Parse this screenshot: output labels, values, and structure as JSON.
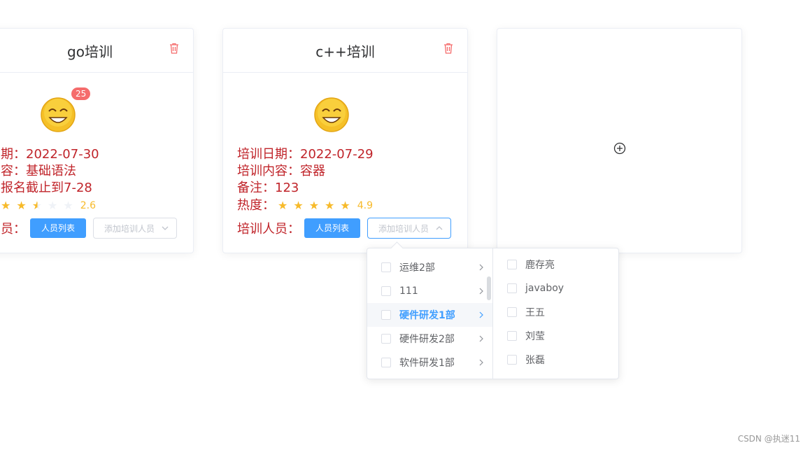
{
  "cards": [
    {
      "title": "go培训",
      "badge": "25",
      "date_line": "期：2022-07-30",
      "content_line": "容：基础语法",
      "note_line": "报名截止到7-28",
      "rating": 2.6,
      "rating_text": "2.6",
      "trainee_label": "员：",
      "list_button": "人员列表",
      "add_placeholder": "添加培训人员"
    },
    {
      "title": "c++培训",
      "date_line": "培训日期：2022-07-29",
      "content_line": "培训内容：容器",
      "note_line": "备注：123",
      "heat_label": "热度：",
      "rating": 4.9,
      "rating_text": "4.9",
      "trainee_label": "培训人员：",
      "list_button": "人员列表",
      "add_placeholder": "添加培训人员"
    }
  ],
  "cascader": {
    "departments": [
      {
        "label": "运维2部"
      },
      {
        "label": "111"
      },
      {
        "label": "硬件研发1部",
        "active": true
      },
      {
        "label": "硬件研发2部"
      },
      {
        "label": "软件研发1部"
      }
    ],
    "members": [
      "鹿存亮",
      "javaboy",
      "王五",
      "刘莹",
      "张磊"
    ]
  },
  "colors": {
    "primary": "#409eff",
    "danger_text": "#c0242a",
    "star": "#f7ba2a",
    "badge": "#f56c6c"
  },
  "icons": {
    "delete": "trash-icon",
    "add": "plus-circle-icon",
    "avatar": "smiley-face-icon"
  },
  "watermark": "CSDN @执迷11"
}
